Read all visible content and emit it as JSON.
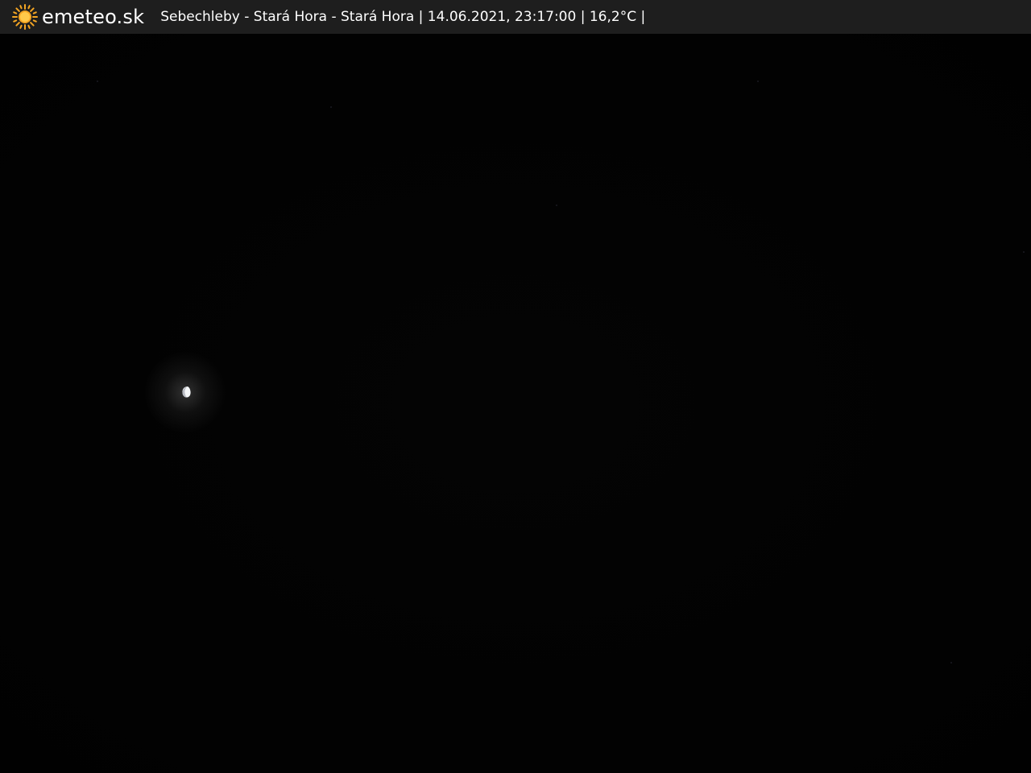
{
  "header": {
    "brand": "emeteo.sk",
    "caption": "Sebechleby - Stará Hora - Stará Hora | 14.06.2021, 23:17:00 | 16,2°C |",
    "logo_icon": "sun-icon",
    "accent_color": "#f5a623"
  },
  "scene": {
    "description_icon": "moon-icon"
  }
}
